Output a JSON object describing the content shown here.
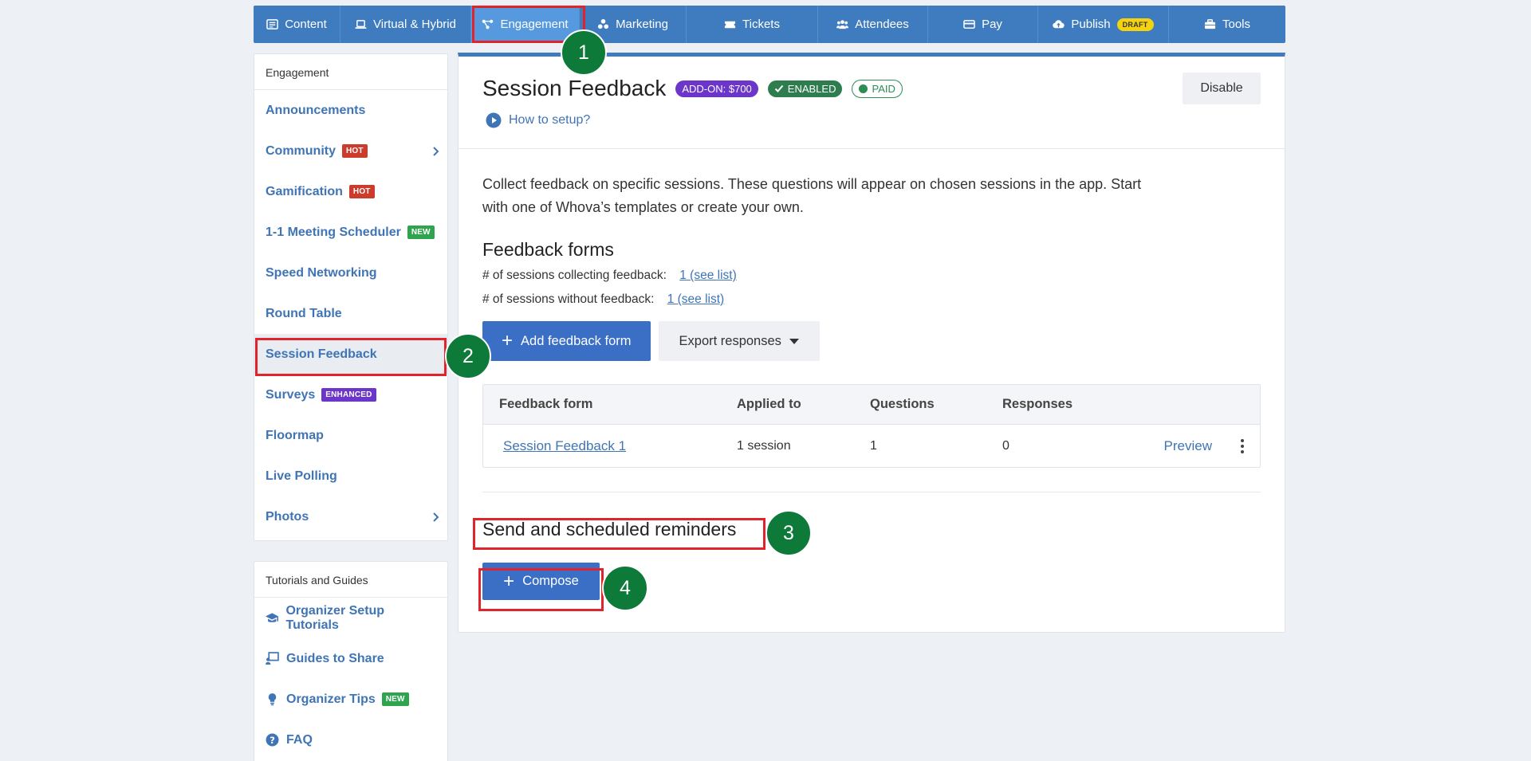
{
  "topnav": {
    "items": [
      {
        "label": "Content",
        "icon": "content-icon"
      },
      {
        "label": "Virtual & Hybrid",
        "icon": "laptop-icon"
      },
      {
        "label": "Engagement",
        "icon": "engagement-icon",
        "active": true
      },
      {
        "label": "Marketing",
        "icon": "marketing-icon"
      },
      {
        "label": "Tickets",
        "icon": "ticket-icon"
      },
      {
        "label": "Attendees",
        "icon": "attendees-icon"
      },
      {
        "label": "Pay",
        "icon": "card-icon"
      },
      {
        "label": "Publish",
        "icon": "cloud-upload-icon",
        "badge": "DRAFT"
      },
      {
        "label": "Tools",
        "icon": "toolbox-icon"
      }
    ]
  },
  "steps": [
    "1",
    "2",
    "3",
    "4"
  ],
  "sidebar": {
    "engagement": {
      "header": "Engagement",
      "items": [
        {
          "label": "Announcements"
        },
        {
          "label": "Community",
          "badge": "HOT"
        },
        {
          "label": "Gamification",
          "badge": "HOT"
        },
        {
          "label": "1-1 Meeting Scheduler",
          "badge": "NEW"
        },
        {
          "label": "Speed Networking"
        },
        {
          "label": "Round Table"
        },
        {
          "label": "Session Feedback",
          "active": true
        },
        {
          "label": "Surveys",
          "badge": "ENHANCED"
        },
        {
          "label": "Floormap"
        },
        {
          "label": "Live Polling"
        },
        {
          "label": "Photos"
        }
      ]
    },
    "tutorials": {
      "header": "Tutorials and Guides",
      "items": [
        {
          "label": "Organizer Setup Tutorials",
          "icon": "graduation-cap-icon"
        },
        {
          "label": "Guides to Share",
          "icon": "presentation-icon"
        },
        {
          "label": "Organizer Tips",
          "icon": "lightbulb-icon",
          "badge": "NEW"
        },
        {
          "label": "FAQ",
          "icon": "question-circle-icon"
        }
      ]
    }
  },
  "main": {
    "title": "Session Feedback",
    "pills": {
      "addon": "ADD-ON: $700",
      "enabled": "ENABLED",
      "paid": "PAID"
    },
    "disable_label": "Disable",
    "howto_label": "How to setup?",
    "description": "Collect feedback on specific sessions. These questions will appear on chosen sessions in the app. Start with one of Whova’s templates or create your own.",
    "forms_heading": "Feedback forms",
    "stat_collecting_label": "# of sessions collecting feedback:",
    "stat_collecting_link": "1 (see list)",
    "stat_without_label": "# of sessions without feedback:",
    "stat_without_link": "1 (see list)",
    "add_form_label": "Add feedback form",
    "export_label": "Export responses",
    "table": {
      "headers": [
        "Feedback form",
        "Applied to",
        "Questions",
        "Responses"
      ],
      "rows": [
        {
          "form": "Session Feedback 1",
          "applied": "1 session",
          "questions": "1",
          "responses": "0",
          "action": "Preview"
        }
      ]
    },
    "reminders_heading": "Send and scheduled reminders",
    "compose_label": "Compose"
  },
  "colors": {
    "nav": "#3f7bbf",
    "accent": "#3a6fc5",
    "highlight": "#e0242c",
    "step": "#0e7a3a"
  }
}
